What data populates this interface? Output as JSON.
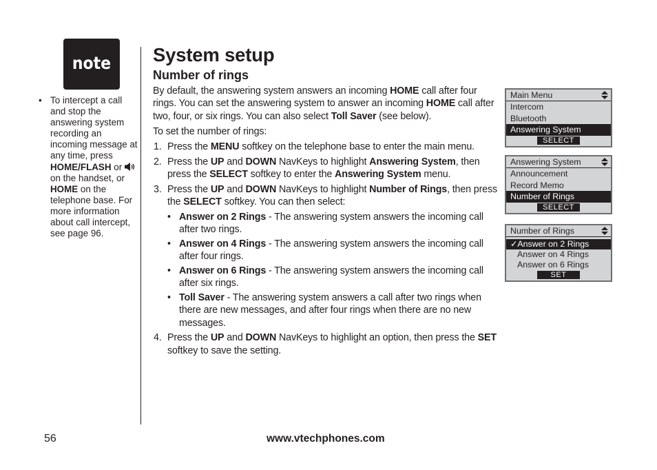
{
  "note_badge": {
    "label": "note"
  },
  "side_note": {
    "bullet": "•",
    "text_1": "To intercept a call and stop the answering system recording an incoming message at any time, press ",
    "key_1": "HOME/FLASH",
    "text_2": " or ",
    "icon": "speakerphone-icon",
    "text_3": " on the handset, or ",
    "key_2": "HOME",
    "text_4": " on the telephone base. For more information about call intercept, see page 96."
  },
  "title": "System setup",
  "subtitle": "Number of rings",
  "intro": {
    "t1": "By default, the answering system answers an incoming ",
    "b1": "HOME",
    "t2": " call after four rings. You can set the answering system to answer an incoming ",
    "b2": "HOME",
    "t3": " call after two, four, or six rings. You can also select ",
    "b3": "Toll Saver",
    "t4": " (see below)."
  },
  "lead": "To set the number of rings:",
  "steps": [
    {
      "num": "1.",
      "t1": "Press the ",
      "b1": "MENU",
      "t2": " softkey on the telephone base to enter the main menu."
    },
    {
      "num": "2.",
      "t1": "Press the ",
      "b1": "UP",
      "t2": " and ",
      "b2": "DOWN",
      "t3": " NavKeys to highlight ",
      "b3": "Answering System",
      "t4": ", then press the ",
      "b4": "SELECT",
      "t5": " softkey to enter the ",
      "b5": "Answering System",
      "t6": " menu."
    },
    {
      "num": "3.",
      "t1": "Press the ",
      "b1": "UP",
      "t2": " and ",
      "b2": "DOWN",
      "t3": " NavKeys to highlight ",
      "b3": "Number of Rings",
      "t4": ", then press the ",
      "b4": "SELECT",
      "t5": " softkey. You can then select:"
    },
    {
      "num": "4.",
      "t1": "Press the ",
      "b1": "UP",
      "t2": " and ",
      "b2": "DOWN",
      "t3": " NavKeys to highlight an option, then press the ",
      "b3": "SET",
      "t4": " softkey to save the setting."
    }
  ],
  "options": [
    {
      "bullet": "•",
      "name": "Answer on 2 Rings",
      "desc": " - The answering system answers the incoming call after two rings."
    },
    {
      "bullet": "•",
      "name": "Answer on 4 Rings",
      "desc": " - The answering system answers the incoming call after four rings."
    },
    {
      "bullet": "•",
      "name": "Answer on 6 Rings",
      "desc": " - The answering system answers the incoming call  after six rings."
    },
    {
      "bullet": "•",
      "name": "Toll Saver",
      "desc": " - The answering system answers a call after two rings when there are new messages, and after four rings when there are no new messages."
    }
  ],
  "screens": [
    {
      "header": "Main Menu",
      "items": [
        "Intercom",
        "Bluetooth",
        "Answering System"
      ],
      "selected": 2,
      "softkey": "SELECT"
    },
    {
      "header": "Answering System",
      "items": [
        "Announcement",
        "Record Memo",
        "Number of Rings"
      ],
      "selected": 2,
      "softkey": "SELECT"
    },
    {
      "header": "Number of Rings",
      "items": [
        "✓Answer on 2 Rings",
        "Answer on 4 Rings",
        "Answer on 6 Rings"
      ],
      "selected": 0,
      "softkey": "SET"
    }
  ],
  "footer": {
    "page_number": "56",
    "url": "www.vtechphones.com"
  }
}
